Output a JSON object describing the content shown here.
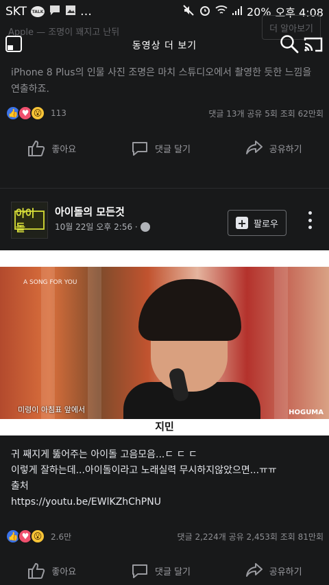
{
  "status_bar": {
    "carrier": "SKT",
    "talk_badge": "TALK",
    "battery": "20%",
    "time": "오후 4:08"
  },
  "ghost_row": {
    "text": "Apple — 조명이 꽤지고 난뒤",
    "button": "더 알아보기"
  },
  "header": {
    "title": "동영상 더 보기"
  },
  "prev_post": {
    "caption": "iPhone 8 Plus의 인물 사진 조명은 마치 스튜디오에서 촬영한 듯한 느낌을 연출하죠.",
    "reaction_count": "113",
    "stats": "댓글 13개  공유 5회  조회 62만회"
  },
  "actions": {
    "like": "좋아요",
    "comment": "댓글 달기",
    "share": "공유하기"
  },
  "post": {
    "page_name": "아이돌의 모든것",
    "avatar_text": "아이돌",
    "date": "10월 22일 오후 2:56 ·",
    "follow_label": "팔로우",
    "video": {
      "top_logo": "A SONG FOR YOU",
      "subtitle": "미령이 아침표 앞에서",
      "watermark": "HOGUMA",
      "caption": "지민"
    },
    "text_lines": [
      "귀 째지게 뚫어주는 아이돌 고음모음...ㄷ ㄷ ㄷ",
      "이렇게 잘하는데...아이돌이라고 노래실력 무시하지않았으면...ㅠㅠ",
      "",
      "출처",
      "https://youtu.be/EWlKZhChPNU"
    ],
    "reaction_count": "2.6만",
    "stats": "댓글 2,224개  공유 2,453회  조회 81만회"
  },
  "colors": {
    "background": "#18191a",
    "like_blue": "#3b73e8",
    "love_pink": "#f0506e",
    "wow_yellow": "#f7c437",
    "avatar_green": "#c7cd33"
  }
}
